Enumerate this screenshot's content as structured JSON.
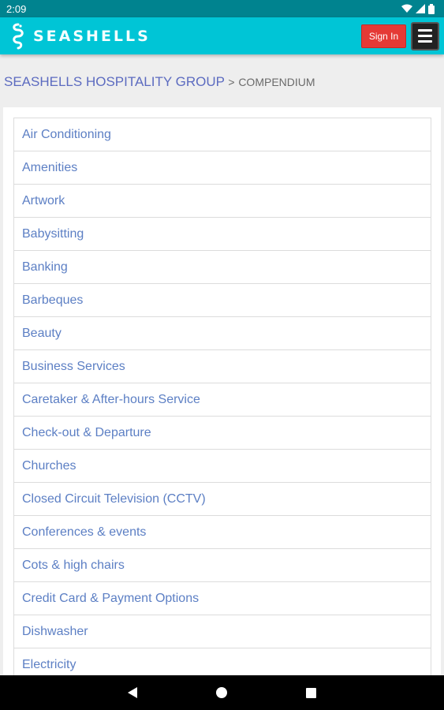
{
  "status": {
    "time": "2:09"
  },
  "header": {
    "brand": "SEASHELLS",
    "signin_label": "Sign In"
  },
  "breadcrumb": {
    "parent": "SEASHELLS HOSPITALITY GROUP",
    "separator": ">",
    "current": "COMPENDIUM"
  },
  "list": {
    "items": [
      "Air Conditioning",
      "Amenities",
      "Artwork",
      "Babysitting",
      "Banking",
      "Barbeques",
      "Beauty",
      "Business Services",
      "Caretaker & After-hours Service",
      "Check-out & Departure",
      "Churches",
      "Closed Circuit Television (CCTV)",
      "Conferences & events",
      "Cots & high chairs",
      "Credit Card & Payment Options",
      "Dishwasher",
      "Electricity"
    ]
  }
}
